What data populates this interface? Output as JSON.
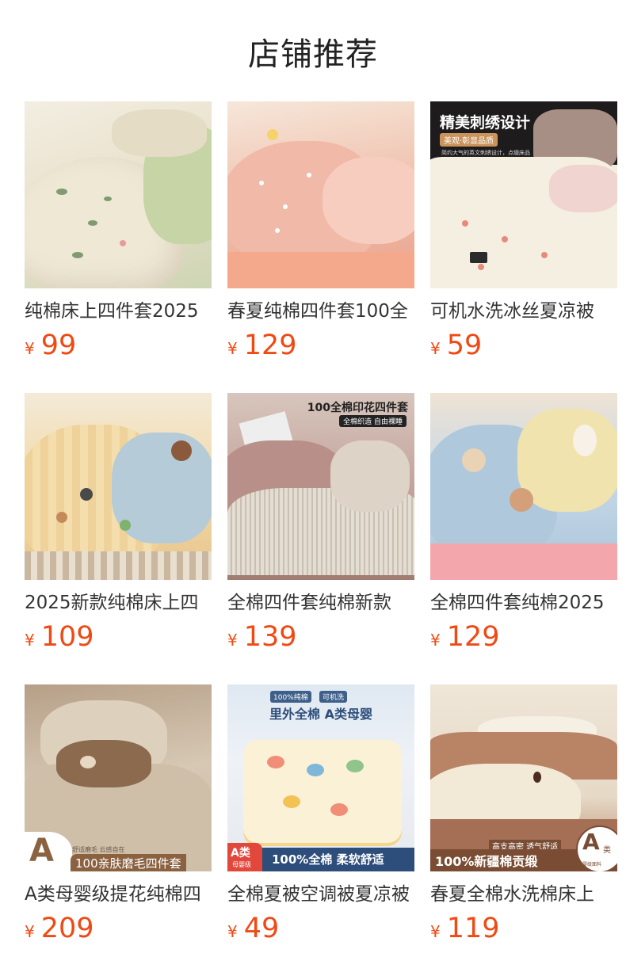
{
  "section_title": "店铺推荐",
  "products": [
    {
      "name": "纯棉床上四件套2025",
      "currency": "¥",
      "price": "99",
      "image": {
        "bg": "#e9e2cf",
        "accent": "#b9c9a0",
        "overlay": []
      }
    },
    {
      "name": "春夏纯棉四件套100全",
      "currency": "¥",
      "price": "129",
      "image": {
        "bg": "#eeb7a5",
        "accent": "#f2c6b4",
        "overlay": []
      }
    },
    {
      "name": "可机水洗冰丝夏凉被",
      "currency": "¥",
      "price": "59",
      "image": {
        "bg": "#f3ecdc",
        "accent": "#d9c2c2",
        "overlay": [
          "精美刺绣设计",
          "美观·彰显品质",
          "简约大气的英文刺绣设计，点缀床品"
        ]
      }
    },
    {
      "name": "2025新款纯棉床上四",
      "currency": "¥",
      "price": "109",
      "image": {
        "bg": "#f2d9a6",
        "accent": "#a9c3d3",
        "overlay": []
      }
    },
    {
      "name": "全棉四件套纯棉新款",
      "currency": "¥",
      "price": "139",
      "image": {
        "bg": "#c9a9a3",
        "accent": "#d6d0c7",
        "overlay": [
          "100全棉印花四件套",
          "全棉织造 自由裸睡"
        ]
      }
    },
    {
      "name": "全棉四件套纯棉2025",
      "currency": "¥",
      "price": "129",
      "image": {
        "bg": "#b8cfe0",
        "accent": "#f0e2a9",
        "overlay": []
      }
    },
    {
      "name": "A类母婴级提花纯棉四",
      "currency": "¥",
      "price": "209",
      "image": {
        "bg": "#c8b8a4",
        "accent": "#9b7a5c",
        "overlay": [
          "A",
          "舒适磨毛 云感自在",
          "100亲肤磨毛四件套"
        ]
      }
    },
    {
      "name": "全棉夏被空调被夏凉被",
      "currency": "¥",
      "price": "49",
      "image": {
        "bg": "#e9eef4",
        "accent": "#f6e6b8",
        "overlay": [
          "100%纯棉",
          "可机洗",
          "里外全棉 A类母婴",
          "A类",
          "母婴级",
          "100%全棉 柔软舒适"
        ]
      }
    },
    {
      "name": "春夏全棉水洗棉床上",
      "currency": "¥",
      "price": "119",
      "image": {
        "bg": "#e8dccb",
        "accent": "#a9775f",
        "overlay": [
          "高支高密 透气舒适",
          "100%新疆棉贡缎",
          "A",
          "类",
          "母婴级面料"
        ]
      }
    }
  ]
}
